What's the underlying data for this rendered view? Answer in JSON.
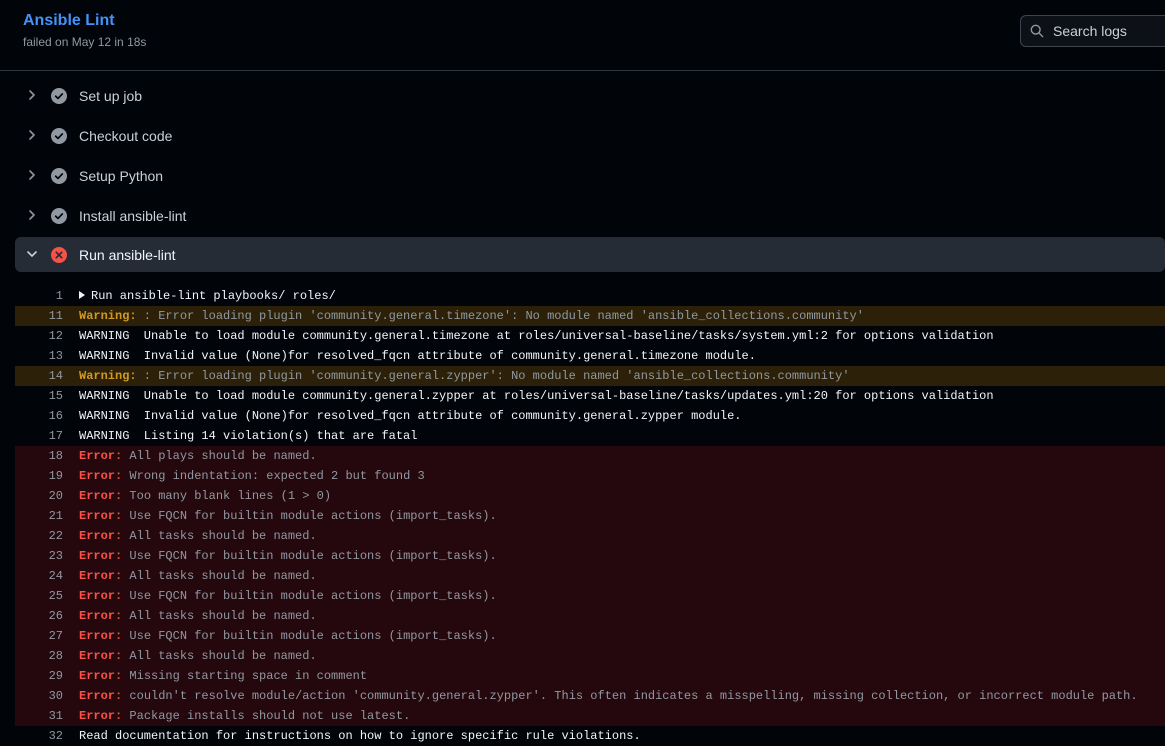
{
  "job": {
    "title": "Ansible Lint",
    "subtitle": "failed on May 12 in 18s"
  },
  "search": {
    "placeholder": "Search logs"
  },
  "steps": [
    {
      "label": "Set up job",
      "status": "success",
      "expanded": false
    },
    {
      "label": "Checkout code",
      "status": "success",
      "expanded": false
    },
    {
      "label": "Setup Python",
      "status": "success",
      "expanded": false
    },
    {
      "label": "Install ansible-lint",
      "status": "success",
      "expanded": false
    },
    {
      "label": "Run ansible-lint",
      "status": "failure",
      "expanded": true
    }
  ],
  "log": [
    {
      "num": "1",
      "type": "group",
      "prefix": "",
      "text": "Run ansible-lint playbooks/ roles/"
    },
    {
      "num": "11",
      "type": "warn",
      "prefix": "Warning:",
      "text": " : Error loading plugin 'community.general.timezone': No module named 'ansible_collections.community'"
    },
    {
      "num": "12",
      "type": "plain",
      "prefix": "",
      "text": "WARNING  Unable to load module community.general.timezone at roles/universal-baseline/tasks/system.yml:2 for options validation"
    },
    {
      "num": "13",
      "type": "plain",
      "prefix": "",
      "text": "WARNING  Invalid value (None)for resolved_fqcn attribute of community.general.timezone module."
    },
    {
      "num": "14",
      "type": "warn",
      "prefix": "Warning:",
      "text": " : Error loading plugin 'community.general.zypper': No module named 'ansible_collections.community'"
    },
    {
      "num": "15",
      "type": "plain",
      "prefix": "",
      "text": "WARNING  Unable to load module community.general.zypper at roles/universal-baseline/tasks/updates.yml:20 for options validation"
    },
    {
      "num": "16",
      "type": "plain",
      "prefix": "",
      "text": "WARNING  Invalid value (None)for resolved_fqcn attribute of community.general.zypper module."
    },
    {
      "num": "17",
      "type": "plain",
      "prefix": "",
      "text": "WARNING  Listing 14 violation(s) that are fatal"
    },
    {
      "num": "18",
      "type": "err",
      "prefix": "Error:",
      "text": " All plays should be named."
    },
    {
      "num": "19",
      "type": "err",
      "prefix": "Error:",
      "text": " Wrong indentation: expected 2 but found 3"
    },
    {
      "num": "20",
      "type": "err",
      "prefix": "Error:",
      "text": " Too many blank lines (1 > 0)"
    },
    {
      "num": "21",
      "type": "err",
      "prefix": "Error:",
      "text": " Use FQCN for builtin module actions (import_tasks)."
    },
    {
      "num": "22",
      "type": "err",
      "prefix": "Error:",
      "text": " All tasks should be named."
    },
    {
      "num": "23",
      "type": "err",
      "prefix": "Error:",
      "text": " Use FQCN for builtin module actions (import_tasks)."
    },
    {
      "num": "24",
      "type": "err",
      "prefix": "Error:",
      "text": " All tasks should be named."
    },
    {
      "num": "25",
      "type": "err",
      "prefix": "Error:",
      "text": " Use FQCN for builtin module actions (import_tasks)."
    },
    {
      "num": "26",
      "type": "err",
      "prefix": "Error:",
      "text": " All tasks should be named."
    },
    {
      "num": "27",
      "type": "err",
      "prefix": "Error:",
      "text": " Use FQCN for builtin module actions (import_tasks)."
    },
    {
      "num": "28",
      "type": "err",
      "prefix": "Error:",
      "text": " All tasks should be named."
    },
    {
      "num": "29",
      "type": "err",
      "prefix": "Error:",
      "text": " Missing starting space in comment"
    },
    {
      "num": "30",
      "type": "err",
      "prefix": "Error:",
      "text": " couldn't resolve module/action 'community.general.zypper'. This often indicates a misspelling, missing collection, or incorrect module path."
    },
    {
      "num": "31",
      "type": "err",
      "prefix": "Error:",
      "text": " Package installs should not use latest."
    },
    {
      "num": "32",
      "type": "plain",
      "prefix": "",
      "text": "Read documentation for instructions on how to ignore specific rule violations."
    }
  ],
  "colors": {
    "success": "#9198a1",
    "failure": "#f85149",
    "warning": "#d29922",
    "link": "#4493f8"
  }
}
